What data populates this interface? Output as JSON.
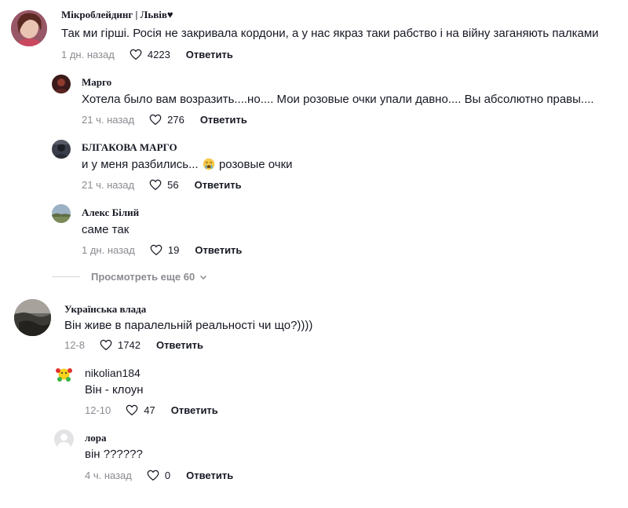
{
  "comments": [
    {
      "author": "Мікроблейдинг | Львів♥",
      "text": "Так ми гірші. Росія не закривала кордони, а у нас якраз таки рабство і на війну заганяють палками",
      "date": "1 дн. назад",
      "likes": "4223",
      "reply_label": "Ответить",
      "replies": [
        {
          "author": "Марго",
          "text": "Хотела было вам возразить....но.... Мои розовые очки упали давно.... Вы абсолютно правы....",
          "date": "21 ч. назад",
          "likes": "276",
          "reply_label": "Ответить"
        },
        {
          "author": "БЛГАКОВА МАРГО",
          "text_before": "и у меня разбились...",
          "emoji": "crying-face-icon",
          "text_after": "розовые очки",
          "date": "21 ч. назад",
          "likes": "56",
          "reply_label": "Ответить"
        },
        {
          "author": "Алекс Білий",
          "text": "саме так",
          "date": "1 дн. назад",
          "likes": "19",
          "reply_label": "Ответить"
        }
      ],
      "view_more": "Просмотреть еще 60"
    },
    {
      "author": "Українська влада",
      "text": "Він живе в паралельній реальності чи що?))))",
      "date": "12-8",
      "likes": "1742",
      "reply_label": "Ответить",
      "replies": [
        {
          "author": "nikolian184",
          "text": "Він - клоун",
          "date": "12-10",
          "likes": "47",
          "reply_label": "Ответить"
        },
        {
          "author": "лора",
          "text": "він ??????",
          "date": "4 ч. назад",
          "likes": "0",
          "reply_label": "Ответить"
        }
      ]
    }
  ],
  "colors": {
    "text": "#161823",
    "meta": "#8a8b91",
    "background": "#ffffff"
  },
  "icons": {
    "like": "heart-outline-icon",
    "expand": "chevron-down-icon"
  }
}
